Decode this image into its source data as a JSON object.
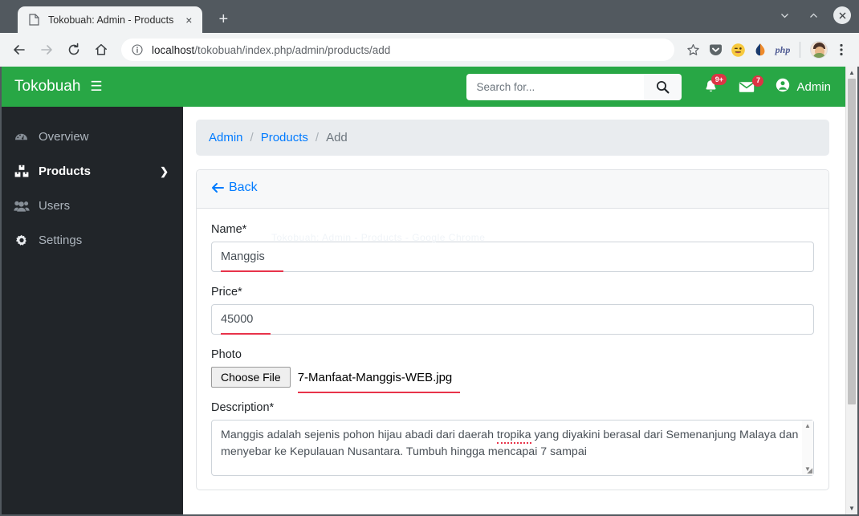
{
  "browser": {
    "tab": {
      "title": "Tokobuah: Admin - Products",
      "favicon": "page-icon",
      "close": "×"
    },
    "new_tab": "+",
    "window_controls": {
      "minimize": "⌄",
      "maximize": "⌃",
      "close": "✕"
    },
    "nav": {
      "back": "←",
      "forward": "→",
      "reload": "⟳",
      "home": "⌂"
    },
    "omnibox": {
      "info_icon": "ⓘ",
      "host": "localhost",
      "path": "/tokobuah/index.php/admin/products/add"
    },
    "toolbar_icons": [
      "bookmark-star-icon",
      "pocket-icon",
      "emoji-icon",
      "droplet-icon",
      "php-icon",
      "profile-avatar",
      "chrome-menu-icon"
    ],
    "php_label": "php"
  },
  "app": {
    "brand": "Tokobuah",
    "burger": "☰"
  },
  "header": {
    "search": {
      "placeholder": "Search for...",
      "value": ""
    },
    "search_button_icon": "search-icon",
    "notifications": {
      "icon": "bell-icon",
      "badge": "9+"
    },
    "messages": {
      "icon": "envelope-icon",
      "badge": "7"
    },
    "user": {
      "icon": "user-circle-icon",
      "label": "Admin"
    }
  },
  "sidebar": {
    "items": [
      {
        "label": "Overview",
        "icon": "tachometer-icon",
        "active": false,
        "chevron": ""
      },
      {
        "label": "Products",
        "icon": "boxes-icon",
        "active": true,
        "chevron": "❯"
      },
      {
        "label": "Users",
        "icon": "users-icon",
        "active": false,
        "chevron": ""
      },
      {
        "label": "Settings",
        "icon": "gear-icon",
        "active": false,
        "chevron": ""
      }
    ]
  },
  "breadcrumb": {
    "admin": "Admin",
    "sep1": "/",
    "products": "Products",
    "sep2": "/",
    "current": "Add"
  },
  "card": {
    "back_label": "Back",
    "back_icon": "arrow-left-icon",
    "watermark": "Tokobuah: Admin - Products - Google Chrome"
  },
  "form": {
    "name": {
      "label": "Name*",
      "value": "Manggis"
    },
    "price": {
      "label": "Price*",
      "value": "45000"
    },
    "photo": {
      "label": "Photo",
      "button": "Choose File",
      "filename": "7-Manfaat-Manggis-WEB.jpg"
    },
    "description": {
      "label": "Description*",
      "line1_a": "Manggis adalah sejenis pohon hijau abadi dari daerah ",
      "line1_spell": "tropika",
      "line1_b": " yang diyakini berasal dari",
      "line2": "Semenanjung Malaya dan menyebar ke Kepulauan Nusantara. Tumbuh hingga mencapai 7 sampai"
    },
    "textarea_scroll": {
      "up": "▲",
      "down": "▼",
      "grip": "◢"
    }
  },
  "page_scrollbar": {
    "up": "▲",
    "down": "▼"
  },
  "colors": {
    "brand_green": "#28a745",
    "sidebar_dark": "#212529",
    "link_blue": "#007bff",
    "badge_red": "#dc3545",
    "annotation_red": "#e8334a",
    "chrome_frame": "#52595f"
  }
}
